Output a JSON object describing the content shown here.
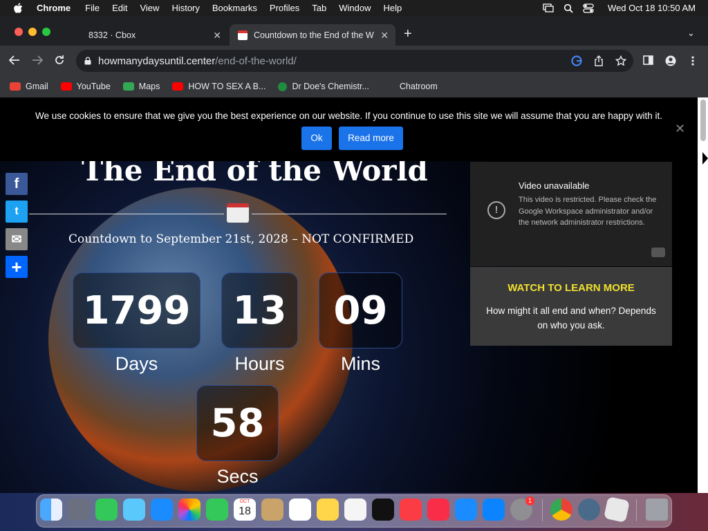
{
  "menubar": {
    "app_name": "Chrome",
    "items": [
      "File",
      "Edit",
      "View",
      "History",
      "Bookmarks",
      "Profiles",
      "Tab",
      "Window",
      "Help"
    ],
    "clock": "Wed Oct 18  10:50 AM"
  },
  "tabs": [
    {
      "title": "8332 · Cbox",
      "active": false
    },
    {
      "title": "Countdown to the End of the W",
      "active": true
    }
  ],
  "toolbar": {
    "url_host": "howmanydaysuntil.center",
    "url_path": "/end-of-the-world/"
  },
  "bookmarks": [
    {
      "label": "Gmail",
      "icon": "gmail-icon",
      "color": "#ea4335"
    },
    {
      "label": "YouTube",
      "icon": "youtube-icon",
      "color": "#ff0000"
    },
    {
      "label": "Maps",
      "icon": "maps-icon",
      "color": "#34a853"
    },
    {
      "label": "HOW TO SEX A B...",
      "icon": "youtube-icon",
      "color": "#ff0000"
    },
    {
      "label": "Dr Doe's Chemistr...",
      "icon": "leaf-icon",
      "color": "#1e8e3e"
    },
    {
      "label": "Chatroom",
      "icon": "",
      "color": ""
    }
  ],
  "cookie_banner": {
    "message": "We use cookies to ensure that we give you the best experience on our website. If you continue to use this site we will assume that you are happy with it.",
    "ok_label": "Ok",
    "read_more_label": "Read more",
    "close_label": "✕"
  },
  "page": {
    "title": "The End of the World",
    "subtitle": "Countdown to September 21st, 2028 – NOT CONFIRMED",
    "countdown": {
      "days": "1799",
      "days_label": "Days",
      "hours": "13",
      "hours_label": "Hours",
      "mins": "09",
      "mins_label": "Mins",
      "secs": "58",
      "secs_label": "Secs"
    },
    "share": [
      {
        "icon": "facebook-icon",
        "glyph": "f",
        "color": "#3b5998"
      },
      {
        "icon": "twitter-icon",
        "glyph": "t",
        "color": "#1da1f2"
      },
      {
        "icon": "email-icon",
        "glyph": "✉",
        "color": "#888888"
      },
      {
        "icon": "share-icon",
        "glyph": "+",
        "color": "#0166ff"
      }
    ]
  },
  "video": {
    "title": "Video unavailable",
    "description": "This video is restricted. Please check the Google Workspace administrator and/or the network administrator restrictions."
  },
  "learn_more": {
    "heading": "WATCH TO LEARN MORE",
    "body": "How might it all end and when?  Depends on who you ask."
  },
  "dock": {
    "calendar_month": "OCT",
    "calendar_day": "18",
    "settings_badge": "1",
    "icons": [
      "finder-icon",
      "launchpad-icon",
      "messages-icon",
      "maps-icon",
      "mail-icon",
      "photos-icon",
      "facetime-icon",
      "calendar-icon",
      "contacts-icon",
      "reminders-icon",
      "notes-icon",
      "freeform-icon",
      "appletv-icon",
      "music-icon",
      "news-icon",
      "keynote-icon",
      "appstore-icon",
      "system-settings-icon",
      "chrome-icon",
      "quicktime-icon",
      "roblox-icon",
      "trash-icon"
    ]
  }
}
